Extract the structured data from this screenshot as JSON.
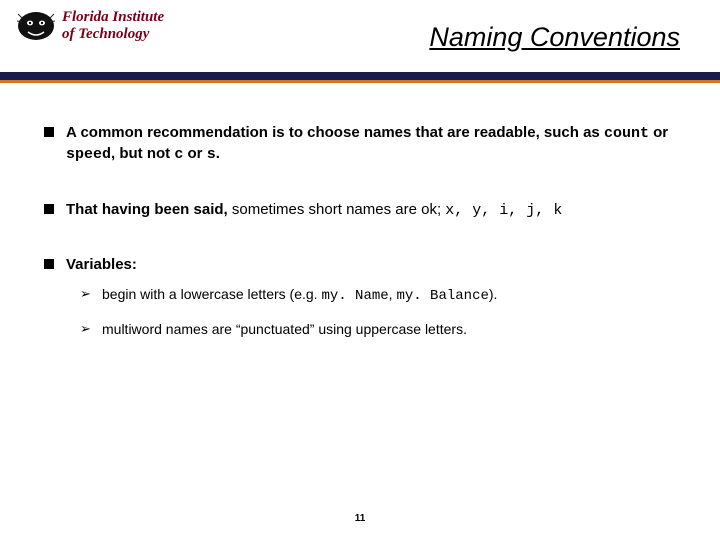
{
  "logo": {
    "line1": "Florida Institute",
    "line2": "of Technology"
  },
  "title": "Naming Conventions",
  "bullets": [
    {
      "pre": "A common recommendation is to choose names that are readable, such as ",
      "code1": "count",
      "mid1": " or ",
      "code2": "speed",
      "mid2": ", but not ",
      "code3": "c",
      "mid3": " or ",
      "code4": "s",
      "post": "."
    },
    {
      "pre": "That having been said, ",
      "plain": "sometimes short names are ok; ",
      "codes": "x, y, i, j, k"
    },
    {
      "pre": "Variables:",
      "subs": [
        {
          "pre": "begin with a lowercase letters (e.g. ",
          "code1": "my. Name",
          "mid": ", ",
          "code2": "my. Balance",
          "post": ")."
        },
        {
          "text": "multiword names are “punctuated” using uppercase letters."
        }
      ]
    }
  ],
  "page_number": "11"
}
